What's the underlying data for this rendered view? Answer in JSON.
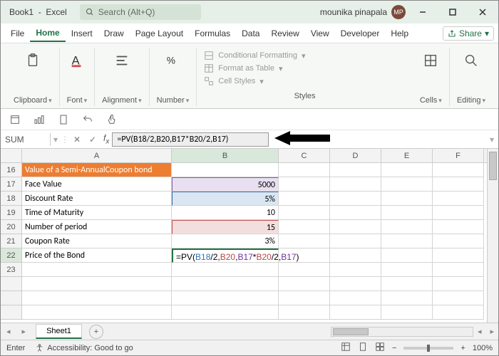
{
  "title": {
    "book": "Book1",
    "app": "Excel",
    "search_placeholder": "Search (Alt+Q)",
    "user": "mounika pinapala",
    "initials": "MP"
  },
  "menu": {
    "file": "File",
    "home": "Home",
    "insert": "Insert",
    "draw": "Draw",
    "page": "Page Layout",
    "formulas": "Formulas",
    "data": "Data",
    "review": "Review",
    "view": "View",
    "developer": "Developer",
    "help": "Help",
    "share": "Share"
  },
  "ribbon": {
    "clipboard": "Clipboard",
    "font": "Font",
    "alignment": "Alignment",
    "number": "Number",
    "cells": "Cells",
    "editing": "Editing",
    "cond": "Conditional Formatting",
    "table": "Format as Table",
    "styles": "Cell Styles",
    "group_styles": "Styles"
  },
  "formula_bar": {
    "name": "SUM",
    "formula": "=PV(B18/2,B20,B17*B20/2,B17)"
  },
  "rows": {
    "r16": {
      "a": "Value of a Semi-AnnualCoupon bond"
    },
    "r17": {
      "a": "Face Value",
      "b": "5000"
    },
    "r18": {
      "a": "Discount Rate",
      "b": "5%"
    },
    "r19": {
      "a": "Time of Maturity",
      "b": "10"
    },
    "r20": {
      "a": "Number of period",
      "b": "15"
    },
    "r21": {
      "a": "Coupon Rate",
      "b": "3%"
    },
    "r22": {
      "a": "Price of the Bond"
    }
  },
  "cell_formula": {
    "pre": "=PV(",
    "b18": "B18",
    "slash2": "/2",
    "c1": ",",
    "b20": "B20",
    "c2": ",",
    "b17": "B17",
    "star": "*",
    "b20b": "B20",
    "tail": "/2",
    "c3": ",",
    "b17b": "B17",
    "close": ")"
  },
  "cols": {
    "a": "A",
    "b": "B",
    "c": "C",
    "d": "D",
    "e": "E",
    "f": "F"
  },
  "rownums": {
    "r16": "16",
    "r17": "17",
    "r18": "18",
    "r19": "19",
    "r20": "20",
    "r21": "21",
    "r22": "22",
    "r23": "23"
  },
  "sheet": {
    "name": "Sheet1"
  },
  "status": {
    "mode": "Enter",
    "acc": "Accessibility: Good to go",
    "zoom": "100%"
  }
}
